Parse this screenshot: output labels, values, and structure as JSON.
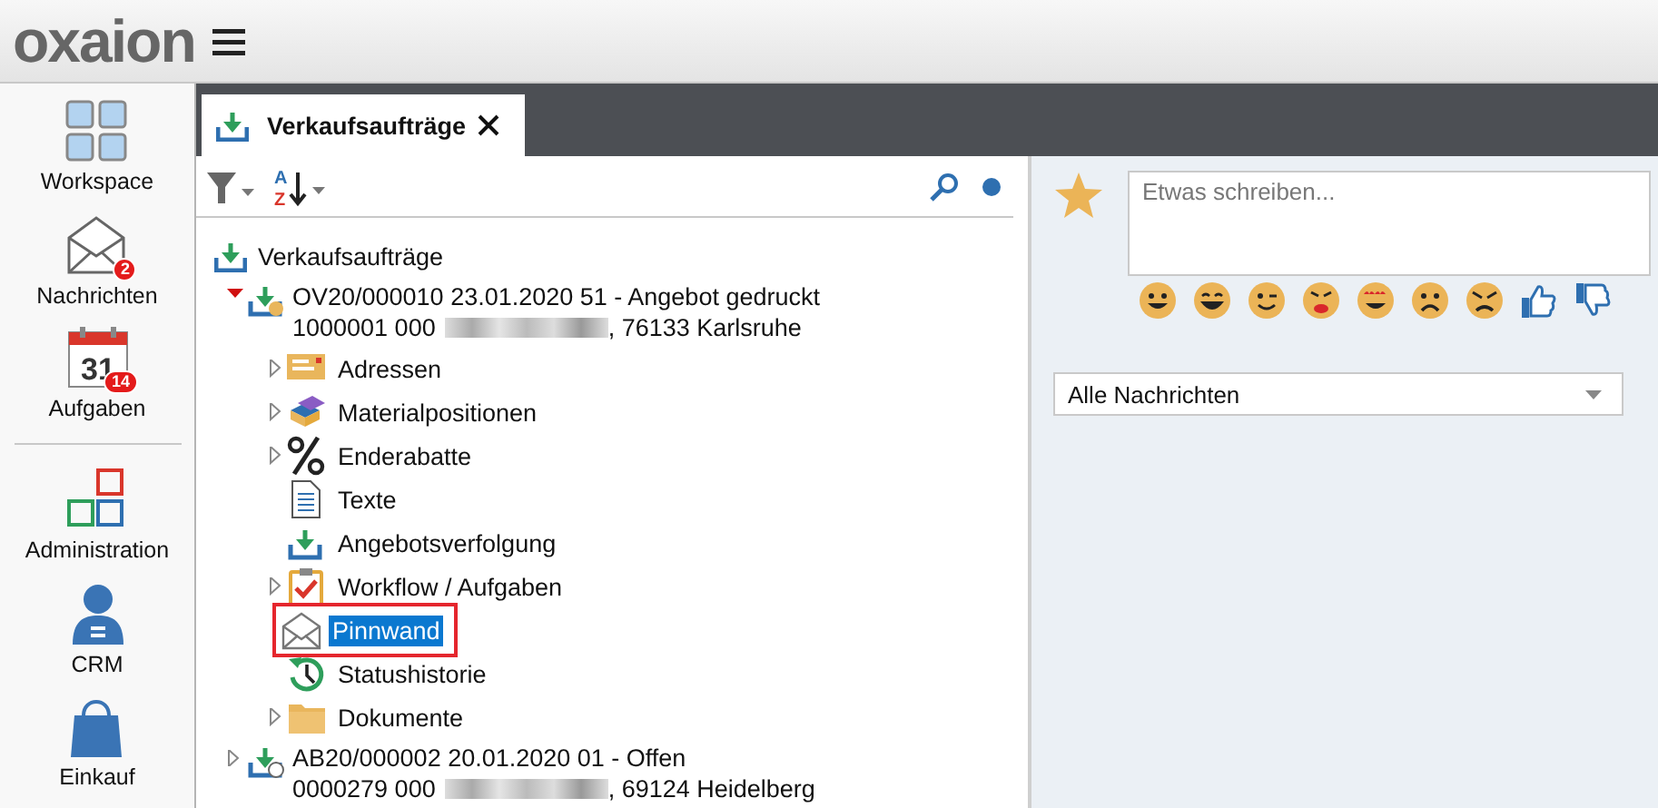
{
  "header": {
    "logo": "oxaion"
  },
  "nav": [
    {
      "kind": "workspace",
      "label": "Workspace"
    },
    {
      "kind": "messages",
      "label": "Nachrichten",
      "badge": "2"
    },
    {
      "kind": "calendar",
      "label": "Aufgaben",
      "badge": "14",
      "day": "31"
    },
    {
      "kind": "divider"
    },
    {
      "kind": "admin",
      "label": "Administration"
    },
    {
      "kind": "crm",
      "label": "CRM"
    },
    {
      "kind": "bag",
      "label": "Einkauf"
    }
  ],
  "sort": {
    "from": "A",
    "to": "Z"
  },
  "tabs": [
    {
      "label": "Verkaufsaufträge",
      "selected": true
    }
  ],
  "tree": {
    "label": "Verkaufsaufträge",
    "children": [
      {
        "kind": "order-open",
        "line1": "OV20/000010 23.01.2020 51 - Angebot gedruckt",
        "line2_start": "1000001 000",
        "line2_end": ", 76133 Karlsruhe",
        "expandable": true,
        "expanded": true,
        "children": [
          {
            "kind": "address",
            "label": "Adressen",
            "expandable": true,
            "selected": false,
            "highlighted": false
          },
          {
            "kind": "material",
            "label": "Materialpositionen",
            "expandable": true,
            "selected": false,
            "highlighted": false
          },
          {
            "kind": "percent",
            "label": "Enderabatte",
            "expandable": true,
            "selected": false,
            "highlighted": false
          },
          {
            "kind": "document",
            "label": "Texte",
            "expandable": false,
            "selected": false,
            "highlighted": false
          },
          {
            "kind": "inbox",
            "label": "Angebotsverfolgung",
            "expandable": false,
            "selected": false,
            "highlighted": false
          },
          {
            "kind": "clipboard",
            "label": "Workflow / Aufgaben",
            "expandable": true,
            "selected": false,
            "highlighted": false
          },
          {
            "kind": "envelope",
            "label": "Pinnwand",
            "expandable": false,
            "selected": true,
            "highlighted": true
          },
          {
            "kind": "history",
            "label": "Statushistorie",
            "expandable": false,
            "selected": false,
            "highlighted": false
          },
          {
            "kind": "folder",
            "label": "Dokumente",
            "expandable": true,
            "selected": false,
            "highlighted": false
          }
        ]
      },
      {
        "kind": "order-closed",
        "line1": "AB20/000002 20.01.2020 01 - Offen",
        "line2_start": "0000279 000",
        "line2_end": ", 69124 Heidelberg",
        "expandable": true,
        "expanded": false
      }
    ]
  },
  "pinboard": {
    "placeholder": "Etwas schreiben...",
    "reactions": [
      {
        "kind": "smile"
      },
      {
        "kind": "laugh"
      },
      {
        "kind": "wink"
      },
      {
        "kind": "kiss"
      },
      {
        "kind": "love"
      },
      {
        "kind": "sad"
      },
      {
        "kind": "angry"
      },
      {
        "kind": "thumbs-up"
      },
      {
        "kind": "thumbs-down"
      }
    ],
    "filter": "Alle Nachrichten"
  }
}
